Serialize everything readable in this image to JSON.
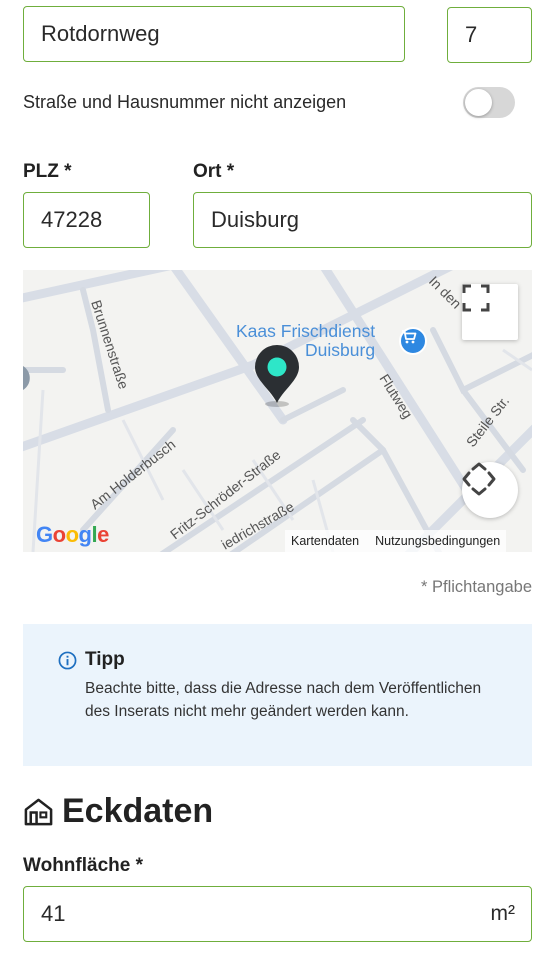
{
  "address": {
    "street_value": "Rotdornweg",
    "house_number_value": "7",
    "hide_address_label": "Straße und Hausnummer nicht anzeigen",
    "plz_label": "PLZ *",
    "plz_value": "47228",
    "city_label": "Ort *",
    "city_value": "Duisburg"
  },
  "map": {
    "poi_name_line1": "Kaas Frischdienst",
    "poi_name_line2": "Duisburg",
    "streets": {
      "brunnen": "Brunnenstraße",
      "holderbusch": "Am Holderbusch",
      "fritz": "Fritz-Schröder-Straße",
      "friedrich": "iedrichstraße",
      "flutweg": "Flutweg",
      "steile": "Steile Str.",
      "inden": "In den"
    },
    "logo_text": "Google",
    "footer_mapdata": "Kartendaten",
    "footer_terms": "Nutzungsbedingungen",
    "pin_color": "#2ee6c8"
  },
  "required_note": "* Pflichtangabe",
  "tip": {
    "title": "Tipp",
    "text": "Beachte bitte, dass die Adresse nach dem Veröffentlichen des Inserats nicht mehr geändert werden kann."
  },
  "section": {
    "title": "Eckdaten",
    "icon": "house-icon"
  },
  "living_area": {
    "label": "Wohnfläche *",
    "value": "41",
    "unit": "m²"
  },
  "colors": {
    "input_border": "#6fae3c",
    "tip_background": "#ebf4fc",
    "info_icon": "#1e6fc0"
  }
}
